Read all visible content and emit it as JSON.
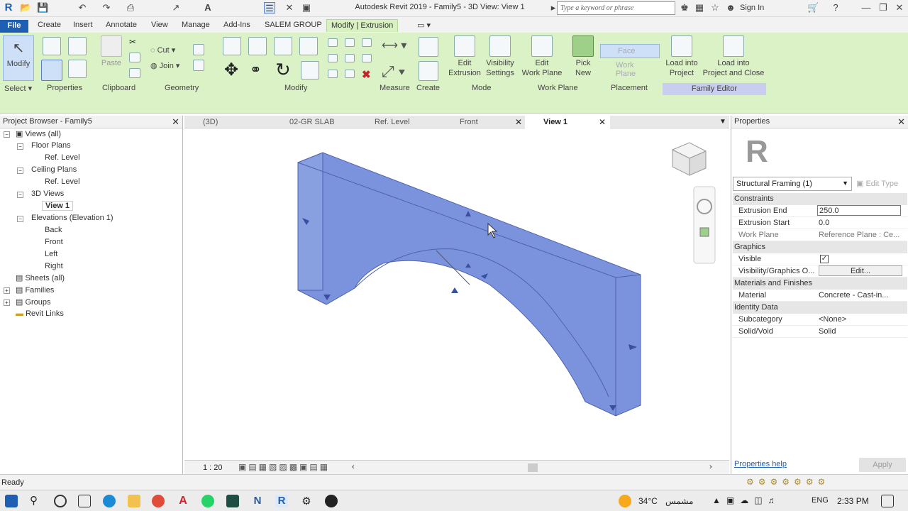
{
  "titlebar": {
    "title": "Autodesk Revit 2019 - Family5 - 3D View: View 1",
    "search_placeholder": "Type a keyword or phrase",
    "sign_in": "Sign In"
  },
  "menu_tabs": [
    "File",
    "Create",
    "Insert",
    "Annotate",
    "View",
    "Manage",
    "Add-Ins",
    "SALEM GROUP",
    "Modify | Extrusion"
  ],
  "ribbon": {
    "modify": "Modify",
    "paste": "Paste",
    "cut": "Cut",
    "join": "Join",
    "edit_extrusion": "Edit\nExtrusion",
    "visibility_settings": "Visibility\nSettings",
    "edit_work_plane": "Edit\nWork Plane",
    "pick_new": "Pick\nNew",
    "face": "Face",
    "work_plane_btn": "Work Plane",
    "load_into_project": "Load into\nProject",
    "load_close": "Load into\nProject and Close",
    "panels": [
      "Select",
      "Properties",
      "Clipboard",
      "Geometry",
      "Modify",
      "Measure",
      "Create",
      "Mode",
      "Work Plane",
      "Placement",
      "Family Editor"
    ]
  },
  "project_browser": {
    "title": "Project Browser - Family5",
    "items": [
      {
        "label": "Views (all)"
      },
      {
        "label": "Floor Plans"
      },
      {
        "label": "Ref. Level"
      },
      {
        "label": "Ceiling Plans"
      },
      {
        "label": "Ref. Level"
      },
      {
        "label": "3D Views"
      },
      {
        "label": "View 1"
      },
      {
        "label": "Elevations (Elevation 1)"
      },
      {
        "label": "Back"
      },
      {
        "label": "Front"
      },
      {
        "label": "Left"
      },
      {
        "label": "Right"
      },
      {
        "label": "Sheets (all)"
      },
      {
        "label": "Families"
      },
      {
        "label": "Groups"
      },
      {
        "label": "Revit Links"
      }
    ]
  },
  "view_tabs": [
    "(3D)",
    "02-GR SLAB",
    "Ref. Level",
    "Front",
    "View 1"
  ],
  "view_status": {
    "scale": "1 : 20"
  },
  "properties": {
    "title": "Properties",
    "type_selector": "Structural Framing (1)",
    "edit_type": "Edit Type",
    "sections": {
      "constraints": "Constraints",
      "graphics": "Graphics",
      "materials": "Materials and Finishes",
      "identity": "Identity Data"
    },
    "rows": {
      "extrusion_end": {
        "k": "Extrusion End",
        "v": "250.0"
      },
      "extrusion_start": {
        "k": "Extrusion Start",
        "v": "0.0"
      },
      "work_plane": {
        "k": "Work Plane",
        "v": "Reference Plane : Ce..."
      },
      "visible": {
        "k": "Visible",
        "v": "✓"
      },
      "vis_graphics": {
        "k": "Visibility/Graphics O...",
        "v": "Edit..."
      },
      "material": {
        "k": "Material",
        "v": "Concrete - Cast-in..."
      },
      "subcategory": {
        "k": "Subcategory",
        "v": "<None>"
      },
      "solid_void": {
        "k": "Solid/Void",
        "v": "Solid"
      }
    },
    "help": "Properties help",
    "apply": "Apply"
  },
  "status": {
    "text": "Ready"
  },
  "taskbar": {
    "temp": "34°C",
    "weather": "مشمس",
    "lang": "ENG",
    "time": "2:33 PM"
  },
  "colors": {
    "accent": "#1e5fb3",
    "ribbon_bg": "#dbf1c6",
    "extrusion_fill": "#7b93dc"
  }
}
